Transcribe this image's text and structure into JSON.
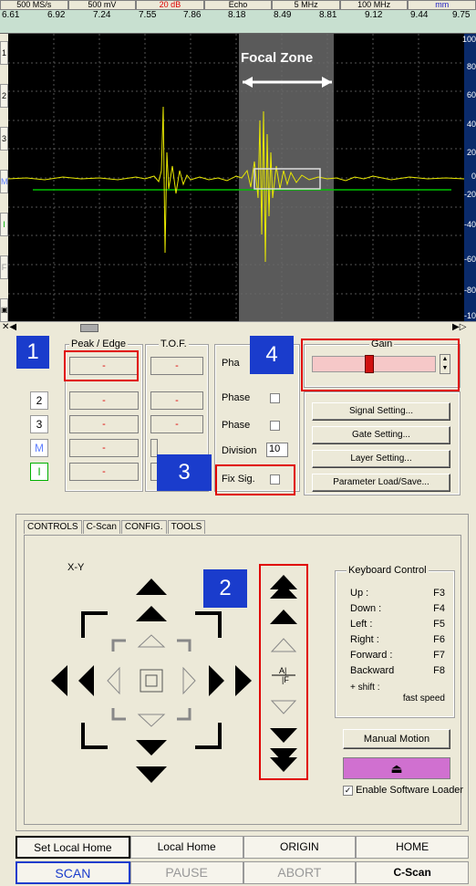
{
  "topbar": [
    "500 MS/s",
    "500 mV",
    "20 dB",
    "Echo",
    "5 MHz",
    "100 MHz",
    "mm"
  ],
  "xticks": [
    "6.61",
    "6.92",
    "7.24",
    "7.55",
    "7.86",
    "8.18",
    "8.49",
    "8.81",
    "9.12",
    "9.44",
    "9.75"
  ],
  "yticks": [
    "100",
    "80",
    "60",
    "40",
    "20",
    "0",
    "-20",
    "-40",
    "-60",
    "-80",
    "-10"
  ],
  "left_tabs": [
    "1",
    "2",
    "3",
    "M",
    "I",
    "F"
  ],
  "focal_zone_label": "Focal Zone",
  "callouts": {
    "one": "1",
    "two": "2",
    "three": "3",
    "four": "4"
  },
  "peak_edge": {
    "header": "Peak / Edge",
    "values": [
      "-",
      "-",
      "-",
      "-",
      "-"
    ]
  },
  "tof": {
    "header": "T.O.F.",
    "values": [
      "-",
      "-",
      "-",
      "-",
      "-"
    ]
  },
  "rows": [
    "1",
    "2",
    "3",
    "M",
    "I"
  ],
  "phase_col": {
    "labels": [
      "Pha",
      "Phase",
      "Phase"
    ],
    "division_label": "Division",
    "division_value": "10",
    "fixsig_label": "Fix Sig."
  },
  "gain": {
    "label": "Gain",
    "level": 0.45
  },
  "settings_buttons": [
    "Signal Setting...",
    "Gate Setting...",
    "Layer Setting...",
    "Parameter Load/Save..."
  ],
  "tabs": [
    "CONTROLS",
    "C-Scan",
    "CONFIG.",
    "TOOLS"
  ],
  "xy_label": "X-Y",
  "keyboard": {
    "title": "Keyboard Control",
    "rows": [
      [
        "Up :",
        "F3"
      ],
      [
        "Down :",
        "F4"
      ],
      [
        "Left :",
        "F5"
      ],
      [
        "Right :",
        "F6"
      ],
      [
        "Forward :",
        "F7"
      ],
      [
        "Backward",
        "F8"
      ]
    ],
    "shift": "+ shift :",
    "fast": "fast speed"
  },
  "manual_motion": "Manual Motion",
  "enable_loader": "Enable Software Loader",
  "home_buttons": [
    "Set Local Home",
    "Local Home",
    "ORIGIN",
    "HOME"
  ],
  "scan_buttons": [
    "SCAN",
    "PAUSE",
    "ABORT",
    "C-Scan"
  ]
}
